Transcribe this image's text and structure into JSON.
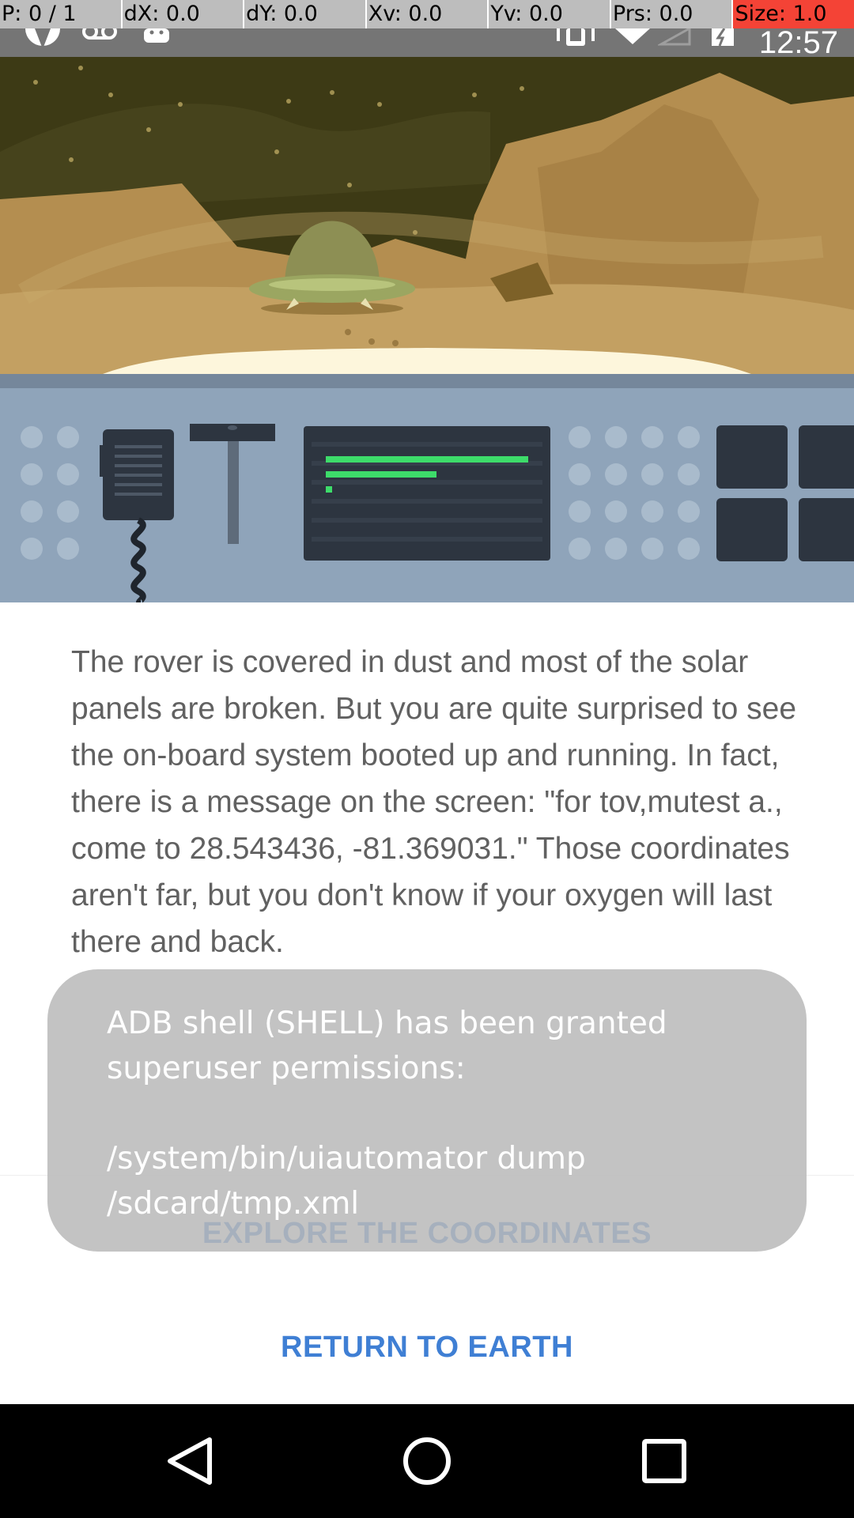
{
  "debug_bar": {
    "pointer": "P: 0 / 1",
    "dx": "dX: 0.0",
    "dy": "dY: 0.0",
    "xv": "Xv: 0.0",
    "yv": "Yv: 0.0",
    "prs": "Prs: 0.0",
    "size": "Size: 1.0"
  },
  "status_bar": {
    "time": "12:57",
    "icons": [
      "app-icon",
      "voicemail-icon",
      "android-icon",
      "vibrate-icon",
      "wifi-icon",
      "signal-icon",
      "battery-charging-icon"
    ]
  },
  "story": {
    "text": "The rover is covered in dust and most of the solar panels are broken. But you are quite surprised to see the on-board system booted up and running. In fact, there is a message on the screen: \"for tov,mutest a., come to 28.543436, -81.369031.\" Those coordinates aren't far, but you don't know if your oxygen will last there and back."
  },
  "actions": {
    "explore": "EXPLORE THE COORDINATES",
    "return": "RETURN TO EARTH"
  },
  "toast": {
    "message": "ADB shell (SHELL) has been granted superuser permissions:\n\n/system/bin/uiautomator dump /sdcard/tmp.xml"
  },
  "colors": {
    "sky": "#3d3a15",
    "sand": "#b48e50",
    "console": "#8fa4ba",
    "screen_green": "#3ddc6a",
    "link": "#3f7fd4"
  }
}
